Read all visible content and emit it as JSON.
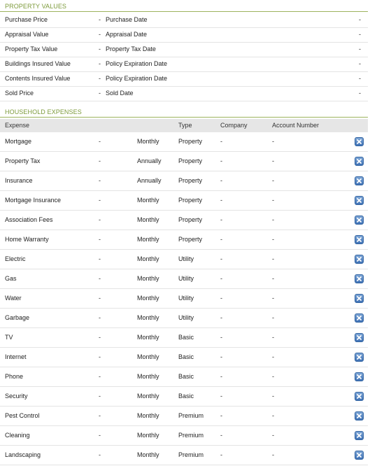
{
  "property_values": {
    "title": "PROPERTY VALUES",
    "rows": [
      {
        "label": "Purchase Price",
        "value": "-",
        "date_label": "Purchase Date",
        "date_value": "-"
      },
      {
        "label": "Appraisal Value",
        "value": "-",
        "date_label": "Appraisal Date",
        "date_value": "-"
      },
      {
        "label": "Property Tax Value",
        "value": "-",
        "date_label": "Property Tax Date",
        "date_value": "-"
      },
      {
        "label": "Buildings Insured Value",
        "value": "-",
        "date_label": "Policy Expiration Date",
        "date_value": "-"
      },
      {
        "label": "Contents Insured Value",
        "value": "-",
        "date_label": "Policy Expiration Date",
        "date_value": "-"
      },
      {
        "label": "Sold Price",
        "value": "-",
        "date_label": "Sold Date",
        "date_value": "-"
      }
    ]
  },
  "household_expenses": {
    "title": "HOUSEHOLD EXPENSES",
    "headers": {
      "expense": "Expense",
      "type": "Type",
      "company": "Company",
      "account": "Account Number"
    },
    "delete_icon": "delete-x-icon",
    "rows": [
      {
        "expense": "Mortgage",
        "value": "-",
        "frequency": "Monthly",
        "type": "Property",
        "company": "-",
        "account": "-"
      },
      {
        "expense": "Property Tax",
        "value": "-",
        "frequency": "Annually",
        "type": "Property",
        "company": "-",
        "account": "-"
      },
      {
        "expense": "Insurance",
        "value": "-",
        "frequency": "Annually",
        "type": "Property",
        "company": "-",
        "account": "-"
      },
      {
        "expense": "Mortgage Insurance",
        "value": "-",
        "frequency": "Monthly",
        "type": "Property",
        "company": "-",
        "account": "-"
      },
      {
        "expense": "Association Fees",
        "value": "-",
        "frequency": "Monthly",
        "type": "Property",
        "company": "-",
        "account": "-"
      },
      {
        "expense": "Home Warranty",
        "value": "-",
        "frequency": "Monthly",
        "type": "Property",
        "company": "-",
        "account": "-"
      },
      {
        "expense": "Electric",
        "value": "-",
        "frequency": "Monthly",
        "type": "Utility",
        "company": "-",
        "account": "-"
      },
      {
        "expense": "Gas",
        "value": "-",
        "frequency": "Monthly",
        "type": "Utility",
        "company": "-",
        "account": "-"
      },
      {
        "expense": "Water",
        "value": "-",
        "frequency": "Monthly",
        "type": "Utility",
        "company": "-",
        "account": "-"
      },
      {
        "expense": "Garbage",
        "value": "-",
        "frequency": "Monthly",
        "type": "Utility",
        "company": "-",
        "account": "-"
      },
      {
        "expense": "TV",
        "value": "-",
        "frequency": "Monthly",
        "type": "Basic",
        "company": "-",
        "account": "-"
      },
      {
        "expense": "Internet",
        "value": "-",
        "frequency": "Monthly",
        "type": "Basic",
        "company": "-",
        "account": "-"
      },
      {
        "expense": "Phone",
        "value": "-",
        "frequency": "Monthly",
        "type": "Basic",
        "company": "-",
        "account": "-"
      },
      {
        "expense": "Security",
        "value": "-",
        "frequency": "Monthly",
        "type": "Basic",
        "company": "-",
        "account": "-"
      },
      {
        "expense": "Pest Control",
        "value": "-",
        "frequency": "Monthly",
        "type": "Premium",
        "company": "-",
        "account": "-"
      },
      {
        "expense": "Cleaning",
        "value": "-",
        "frequency": "Monthly",
        "type": "Premium",
        "company": "-",
        "account": "-"
      },
      {
        "expense": "Landscaping",
        "value": "-",
        "frequency": "Monthly",
        "type": "Premium",
        "company": "-",
        "account": "-"
      }
    ]
  },
  "colors": {
    "section_title": "#7c9a3a",
    "section_rule": "#9db35e",
    "header_bg": "#e6e6e6",
    "delete_button": "#3f72b5"
  }
}
